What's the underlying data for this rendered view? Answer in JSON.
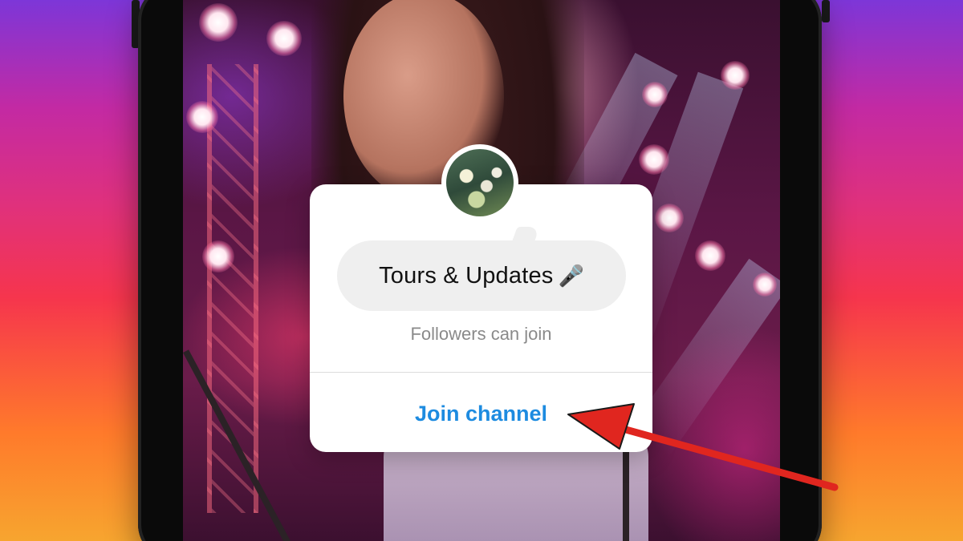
{
  "channel_popup": {
    "channel_name": "Tours & Updates",
    "channel_emoji": "🎤",
    "subtext": "Followers can join",
    "join_button_label": "Join channel"
  },
  "colors": {
    "background_gradient": [
      "#f7a52f",
      "#f6354d",
      "#c32aa3",
      "#7d36d8"
    ],
    "join_button": "#1d8be0",
    "annotation_arrow": "#e0261f",
    "card_background": "#ffffff",
    "bubble_background": "#efefef"
  },
  "icons": {
    "channel_emoji": "microphone-icon",
    "avatar": "channel-avatar-image",
    "annotation": "red-arrow-icon"
  }
}
